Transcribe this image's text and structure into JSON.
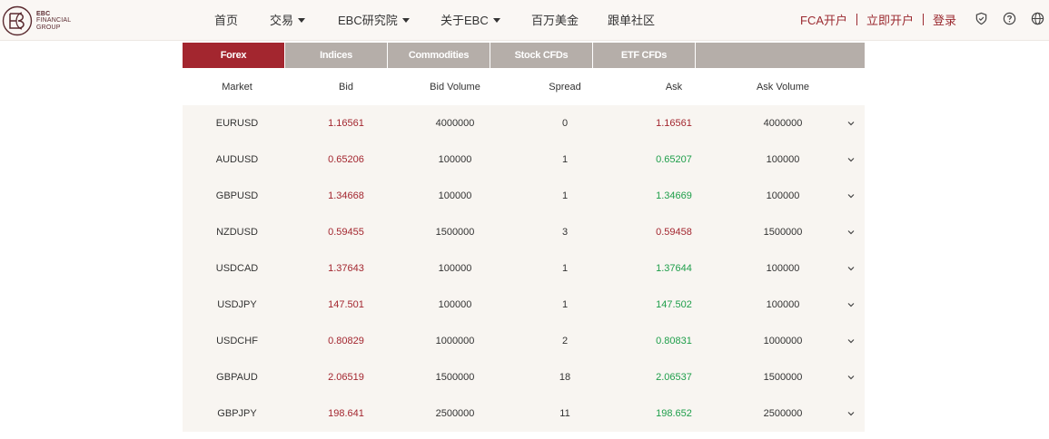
{
  "brand": {
    "logo_line1": "EBC",
    "logo_line2": "FINANCIAL",
    "logo_line3": "GROUP",
    "accent": "#a3262f"
  },
  "nav": {
    "items": [
      {
        "label": "首页",
        "dropdown": false
      },
      {
        "label": "交易",
        "dropdown": true
      },
      {
        "label": "EBC研究院",
        "dropdown": true
      },
      {
        "label": "关于EBC",
        "dropdown": true
      },
      {
        "label": "百万美金",
        "dropdown": false
      },
      {
        "label": "跟单社区",
        "dropdown": false
      }
    ]
  },
  "account": {
    "fca": "FCA开户",
    "open": "立即开户",
    "login": "登录"
  },
  "header_icons": [
    "shield-icon",
    "help-icon",
    "globe-icon"
  ],
  "tabs": [
    {
      "label": "Forex",
      "active": true
    },
    {
      "label": "Indices",
      "active": false
    },
    {
      "label": "Commodities",
      "active": false
    },
    {
      "label": "Stock CFDs",
      "active": false
    },
    {
      "label": "ETF CFDs",
      "active": false
    }
  ],
  "table": {
    "headers": [
      "Market",
      "Bid",
      "Bid Volume",
      "Spread",
      "Ask",
      "Ask Volume"
    ],
    "rows": [
      {
        "market": "EURUSD",
        "bid": "1.16561",
        "bid_volume": "4000000",
        "spread": "0",
        "ask": "1.16561",
        "ask_volume": "4000000",
        "ask_color": "red"
      },
      {
        "market": "AUDUSD",
        "bid": "0.65206",
        "bid_volume": "100000",
        "spread": "1",
        "ask": "0.65207",
        "ask_volume": "100000",
        "ask_color": "green"
      },
      {
        "market": "GBPUSD",
        "bid": "1.34668",
        "bid_volume": "100000",
        "spread": "1",
        "ask": "1.34669",
        "ask_volume": "100000",
        "ask_color": "green"
      },
      {
        "market": "NZDUSD",
        "bid": "0.59455",
        "bid_volume": "1500000",
        "spread": "3",
        "ask": "0.59458",
        "ask_volume": "1500000",
        "ask_color": "red"
      },
      {
        "market": "USDCAD",
        "bid": "1.37643",
        "bid_volume": "100000",
        "spread": "1",
        "ask": "1.37644",
        "ask_volume": "100000",
        "ask_color": "green"
      },
      {
        "market": "USDJPY",
        "bid": "147.501",
        "bid_volume": "100000",
        "spread": "1",
        "ask": "147.502",
        "ask_volume": "100000",
        "ask_color": "green"
      },
      {
        "market": "USDCHF",
        "bid": "0.80829",
        "bid_volume": "1000000",
        "spread": "2",
        "ask": "0.80831",
        "ask_volume": "1000000",
        "ask_color": "green"
      },
      {
        "market": "GBPAUD",
        "bid": "2.06519",
        "bid_volume": "1500000",
        "spread": "18",
        "ask": "2.06537",
        "ask_volume": "1500000",
        "ask_color": "green"
      },
      {
        "market": "GBPJPY",
        "bid": "198.641",
        "bid_volume": "2500000",
        "spread": "11",
        "ask": "198.652",
        "ask_volume": "2500000",
        "ask_color": "green"
      }
    ]
  },
  "colors": {
    "bid": "#a3262f",
    "ask_up": "#1e9e4a",
    "ask_down": "#a3262f",
    "tab_inactive": "#b5aea9",
    "row_bg": "#f8f5f1"
  }
}
